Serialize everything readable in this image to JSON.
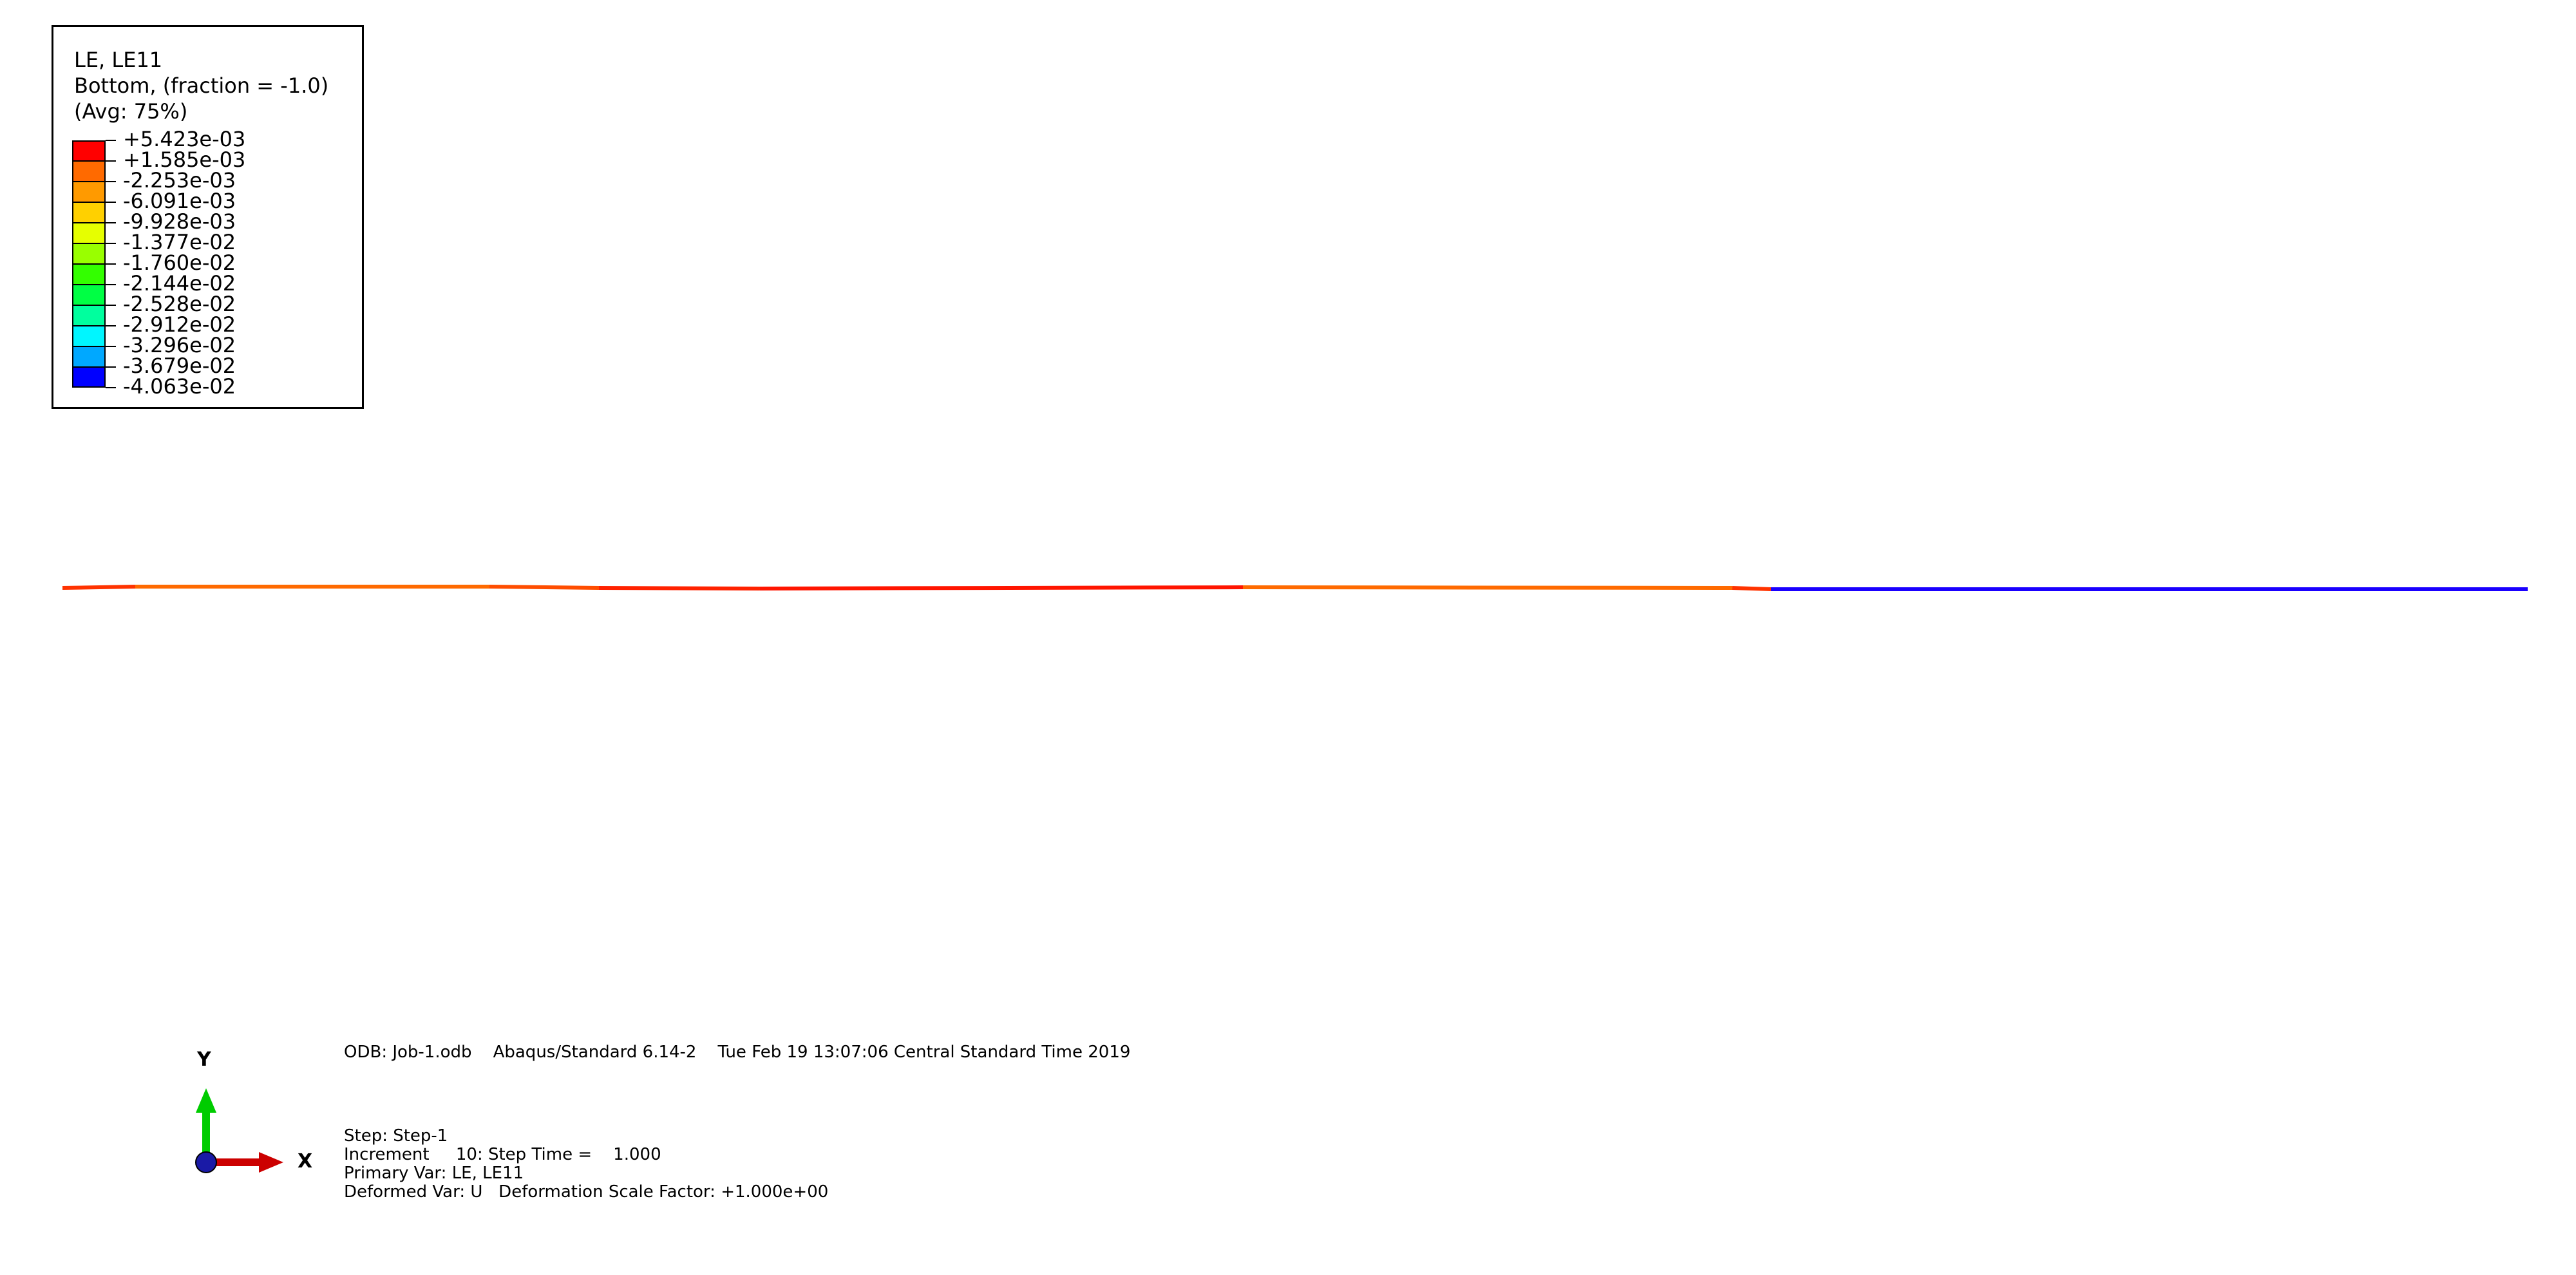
{
  "legend": {
    "title_lines": [
      "LE, LE11",
      "Bottom, (fraction = -1.0)",
      "(Avg: 75%)"
    ],
    "entries": [
      {
        "value": "+5.423e-03",
        "color": "#ff0000"
      },
      {
        "value": "+1.585e-03",
        "color": "#ff6a00"
      },
      {
        "value": "-2.253e-03",
        "color": "#ff9a00"
      },
      {
        "value": "-6.091e-03",
        "color": "#ffd000"
      },
      {
        "value": "-9.928e-03",
        "color": "#e6ff00"
      },
      {
        "value": "-1.377e-02",
        "color": "#99ff00"
      },
      {
        "value": "-1.760e-02",
        "color": "#33ff00"
      },
      {
        "value": "-2.144e-02",
        "color": "#00ff44"
      },
      {
        "value": "-2.528e-02",
        "color": "#00ff9e"
      },
      {
        "value": "-2.912e-02",
        "color": "#00f6ff"
      },
      {
        "value": "-3.296e-02",
        "color": "#00a8ff"
      },
      {
        "value": "-3.679e-02",
        "color": "#0050ff"
      },
      {
        "value": "-4.063e-02",
        "color": "#0000ff"
      }
    ]
  },
  "model": {
    "segments": [
      {
        "color": "#ff3300"
      },
      {
        "color": "#ff6a00"
      },
      {
        "color": "#ff4d00"
      },
      {
        "color": "#ff2200"
      },
      {
        "color": "#ff1500"
      },
      {
        "color": "#ff6a00"
      },
      {
        "color": "#ff3300"
      },
      {
        "color": "#1a00ff"
      }
    ]
  },
  "triad": {
    "x_label": "X",
    "y_label": "Y",
    "x_color": "#cc0000",
    "y_color": "#00cc00",
    "origin_color": "#1a1aa6"
  },
  "info": {
    "odb_line": "ODB: Job-1.odb    Abaqus/Standard 6.14-2    Tue Feb 19 13:07:06 Central Standard Time 2019",
    "step_line": "Step: Step-1",
    "increment_line": "Increment     10: Step Time =    1.000",
    "primary_line": "Primary Var: LE, LE11",
    "deformed_line": "Deformed Var: U   Deformation Scale Factor: +1.000e+00"
  }
}
